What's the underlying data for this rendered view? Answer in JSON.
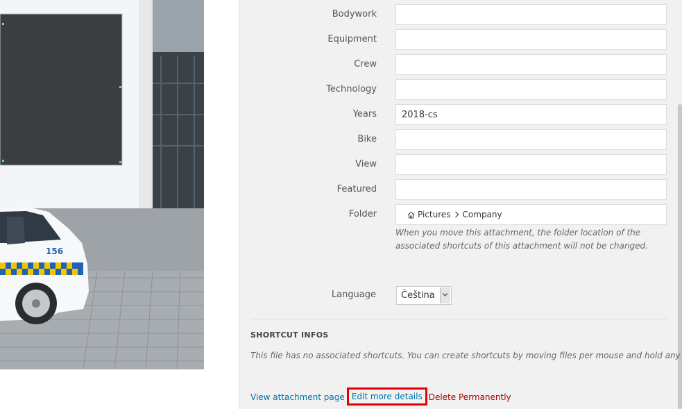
{
  "attachment_fields": [
    {
      "label": "Bodywork",
      "value": ""
    },
    {
      "label": "Equipment",
      "value": ""
    },
    {
      "label": "Crew",
      "value": ""
    },
    {
      "label": "Technology",
      "value": ""
    },
    {
      "label": "Years",
      "value": "2018-cs"
    },
    {
      "label": "Bike",
      "value": ""
    },
    {
      "label": "View",
      "value": ""
    },
    {
      "label": "Featured",
      "value": ""
    }
  ],
  "folder": {
    "label": "Folder",
    "path": [
      "Pictures",
      "Company"
    ],
    "note": "When you move this attachment, the folder location of the associated shortcuts of this attachment will not be changed."
  },
  "language": {
    "label": "Language",
    "selected": "Čeština"
  },
  "shortcut_infos": {
    "heading": "SHORTCUT INFOS",
    "note": "This file has no associated shortcuts. You can create shortcuts by moving files per mouse and hold any key."
  },
  "actions": {
    "view": "View attachment page",
    "edit": "Edit more details",
    "delete": "Delete Permanently"
  },
  "preview": {
    "car_badge_text": "156"
  },
  "colors": {
    "link": "#0073aa",
    "delete": "#aa0000",
    "highlight": "#e00000",
    "panel_bg": "#f1f1f1"
  }
}
